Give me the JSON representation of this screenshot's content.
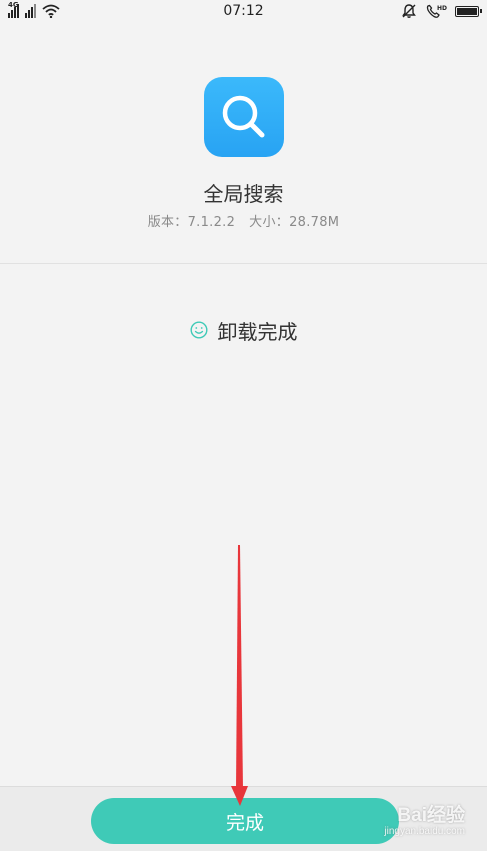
{
  "status_bar": {
    "time": "07:12",
    "left_icons": [
      "signal-4g-icon",
      "signal-icon",
      "wifi-icon"
    ],
    "right_icons": [
      "alarm-icon",
      "hd-call-icon",
      "battery-icon"
    ],
    "network_label": "4G",
    "hd_label": "HD",
    "battery_level": 1.0
  },
  "app": {
    "icon": "search-icon",
    "icon_color": "#2fb0f8",
    "name": "全局搜索",
    "version_label": "版本：7.1.2.2",
    "size_label": "大小：28.78M"
  },
  "result": {
    "icon": "smile-icon",
    "icon_color": "#3fcab7",
    "text": "卸载完成"
  },
  "bottom": {
    "done_label": "完成",
    "button_color": "#3fcab7"
  },
  "annotation": {
    "arrow_color": "#e8363b"
  },
  "watermark": {
    "text": "Bai经验",
    "sub": "jingyan.baidu.com"
  }
}
